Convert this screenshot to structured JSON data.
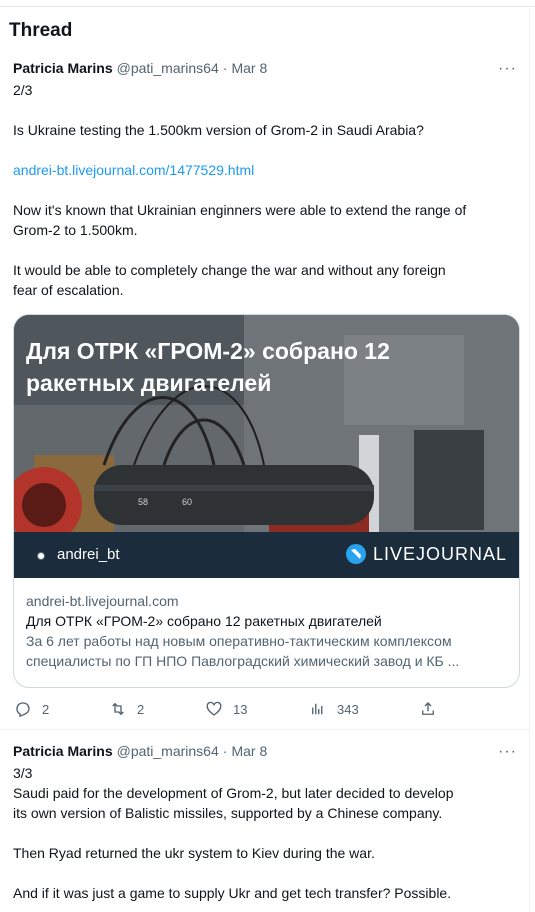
{
  "page": {
    "title": "Thread"
  },
  "tweets": [
    {
      "name": "Patricia Marins",
      "handle": "@pati_marins64",
      "separator": "·",
      "date": "Mar 8",
      "more": "···",
      "lines": [
        "2/3",
        "",
        "Is Ukraine testing the 1.500km version of Grom-2 in Saudi Arabia?",
        "",
        "Now it's known that Ukrainian enginners were able to extend the range of",
        "Grom-2 to 1.500km.",
        "",
        "It would be able to completely change the war and without any foreign",
        "fear of escalation."
      ],
      "link": "andrei-bt.livejournal.com/1477529.html",
      "card": {
        "headline_line1": "Для ОТРК «ГРОМ-2» собрано 12",
        "headline_line2": "ракетных двигателей",
        "brand_user": "andrei_bt",
        "brand_name": "LIVEJOURNAL",
        "domain": "andrei-bt.livejournal.com",
        "title": "Для ОТРК «ГРОМ-2» собрано 12 ракетных двигателей",
        "desc_line1": "За 6 лет работы над новым оперативно-тактическим комплексом",
        "desc_line2": "специалисты по ГП НПО Павлоградский химический завод и КБ ...",
        "image_labels": [
          "58",
          "60"
        ]
      },
      "actions": {
        "replies": "2",
        "retweets": "2",
        "likes": "13",
        "views": "343"
      }
    },
    {
      "name": "Patricia Marins",
      "handle": "@pati_marins64",
      "separator": "·",
      "date": "Mar 8",
      "more": "···",
      "lines": [
        "3/3",
        "Saudi paid for the development of Grom-2, but later decided to develop",
        "its own version of Balistic missiles, supported by a Chinese company.",
        "",
        "Then Ryad returned the ukr system to Kiev during the war.",
        "",
        "And if it was just a game to supply Ukr and get tech transfer? Possible."
      ]
    }
  ],
  "colors": {
    "link": "#1d9bf0",
    "muted": "#536471",
    "brand_bar": "#1b2d3c"
  },
  "icons": [
    "reply-icon",
    "retweet-icon",
    "like-icon",
    "views-icon",
    "share-icon",
    "more-icon",
    "livejournal-logo-icon"
  ]
}
